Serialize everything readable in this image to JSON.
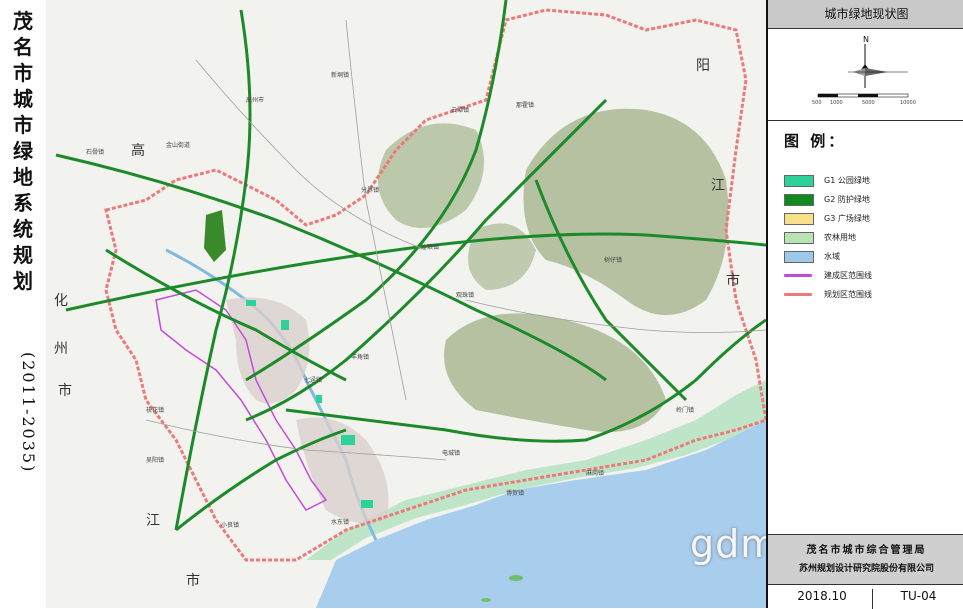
{
  "title": {
    "main": "茂名市城市绿地系统规划",
    "period": "(2011-2035)"
  },
  "panel": {
    "map_title": "城市绿地现状图",
    "north": "N",
    "scale": [
      "500",
      "1000",
      "5000",
      "10000"
    ],
    "legend_title": "图 例：",
    "legend": [
      "G1 公园绿地",
      "G2 防护绿地",
      "G3 广场绿地",
      "农林用地",
      "水域",
      "建成区范围线",
      "规划区范围线"
    ],
    "org_client": "茂名市城市综合管理局",
    "org_designer": "苏州规划设计研究院股份有限公司",
    "date": "2018.10",
    "drawing_no": "TU-04"
  },
  "map": {
    "region_labels": [
      "高",
      "阳",
      "江",
      "市",
      "化",
      "州",
      "市",
      "江",
      "市"
    ],
    "places": [
      "金山街道",
      "石骨镇",
      "高州市",
      "新垌镇",
      "云潭镇",
      "那霍镇",
      "分界镇",
      "沙琅镇",
      "羊角镇",
      "观珠镇",
      "电城镇",
      "博贺镇",
      "麻岗镇",
      "岭门镇",
      "袂花镇",
      "吴阳镇",
      "小良镇",
      "七迳镇",
      "树仔镇",
      "水东镇"
    ],
    "colors": {
      "park": "#2fd19a",
      "protective": "#0e8a1e",
      "square": "#f7e08a",
      "farmland": "#b9e3b2",
      "water": "#9cc9ea",
      "built_boundary": "#c44bd9",
      "planning_boundary": "#ec7a7a"
    }
  },
  "watermark": "gdmm.com"
}
